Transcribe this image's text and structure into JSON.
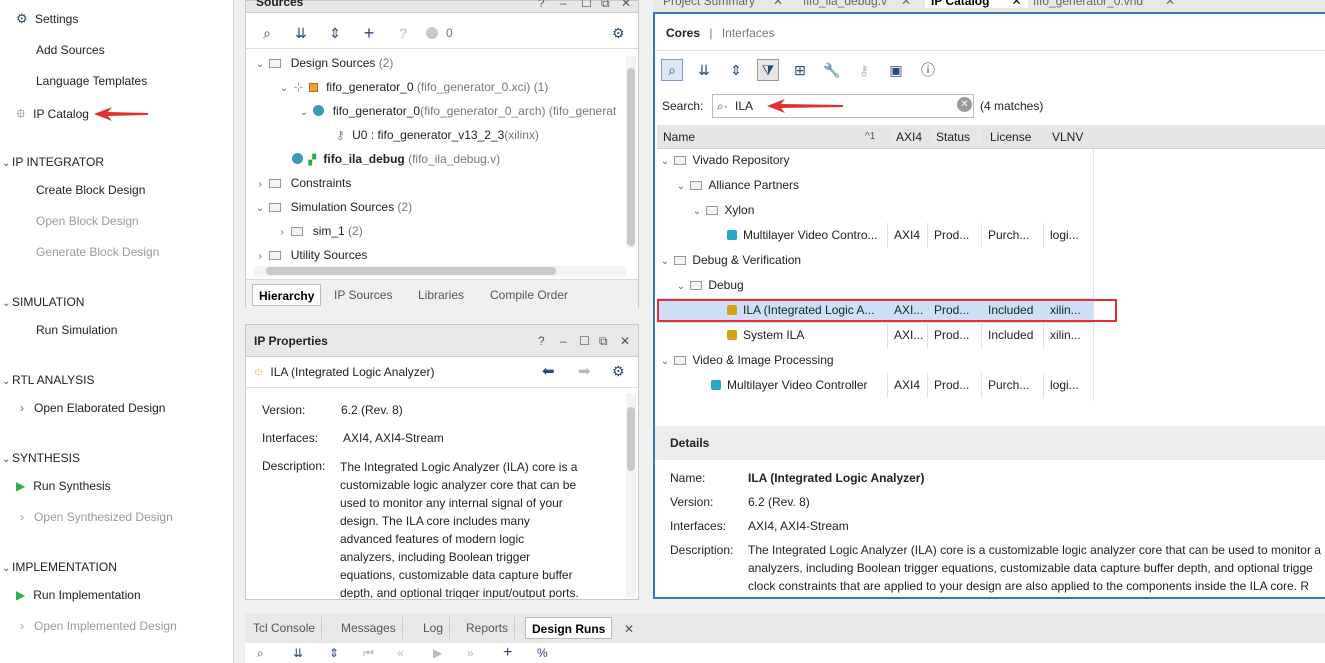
{
  "flow": {
    "settings": "Settings",
    "add_sources": "Add Sources",
    "language_templates": "Language Templates",
    "ip_catalog": "IP Catalog",
    "ip_integrator": "IP INTEGRATOR",
    "create_block_design": "Create Block Design",
    "open_block_design": "Open Block Design",
    "generate_block_design": "Generate Block Design",
    "simulation": "SIMULATION",
    "run_simulation": "Run Simulation",
    "rtl_analysis": "RTL ANALYSIS",
    "open_elaborated_design": "Open Elaborated Design",
    "synthesis": "SYNTHESIS",
    "run_synthesis": "Run Synthesis",
    "open_synthesized_design": "Open Synthesized Design",
    "implementation": "IMPLEMENTATION",
    "run_implementation": "Run Implementation",
    "open_implemented_design": "Open Implemented Design"
  },
  "sources": {
    "title": "Sources",
    "count_badge": "0",
    "design_sources": "Design Sources",
    "design_sources_count": "(2)",
    "fifo_gen": "fifo_generator_0",
    "fifo_gen_file": "(fifo_generator_0.xci) (1)",
    "fifo_gen_arch": "fifo_generator_0",
    "fifo_gen_arch_detail": "(fifo_generator_0_arch) (fifo_generat",
    "u0": "U0 : fifo_generator_v13_2_3",
    "u0_lib": "(xilinx)",
    "fifo_ila_debug": "fifo_ila_debug",
    "fifo_ila_debug_file": "(fifo_ila_debug.v)",
    "constraints": "Constraints",
    "simulation_sources": "Simulation Sources",
    "simulation_sources_count": "(2)",
    "sim_1": "sim_1",
    "sim_1_count": "(2)",
    "utility_sources": "Utility Sources",
    "tabs": [
      "Hierarchy",
      "IP Sources",
      "Libraries",
      "Compile Order"
    ]
  },
  "ip_properties": {
    "title": "IP Properties",
    "name": "ILA (Integrated Logic Analyzer)",
    "version_label": "Version:",
    "version": "6.2 (Rev. 8)",
    "interfaces_label": "Interfaces:",
    "interfaces": "AXI4, AXI4-Stream",
    "description_label": "Description:",
    "description_lines": [
      "The Integrated Logic Analyzer (ILA) core is a",
      "customizable logic analyzer core that can be",
      "used to monitor any internal signal of your",
      "design. The ILA core includes many",
      "advanced features of modern logic",
      "analyzers, including Boolean trigger",
      "equations, customizable data capture buffer",
      "depth, and optional trigger input/output ports."
    ]
  },
  "editor_tabs": [
    "Project Summary",
    "fifo_ila_debug.v",
    "IP Catalog",
    "fifo_generator_0.vhd"
  ],
  "catalog": {
    "subtab_cores": "Cores",
    "subtab_sep": "|",
    "subtab_interfaces": "Interfaces",
    "search_label": "Search:",
    "search_value": "ILA",
    "matches": "(4 matches)",
    "columns": [
      "Name",
      "AXI4",
      "Status",
      "License",
      "VLNV"
    ],
    "sort_indicator": "^1",
    "tree": {
      "vivado_repository": "Vivado Repository",
      "alliance_partners": "Alliance Partners",
      "xylon": "Xylon",
      "debug_verification": "Debug & Verification",
      "debug": "Debug",
      "video_image": "Video & Image Processing"
    },
    "rows": [
      {
        "name": "Multilayer Video Contro...",
        "axi4": "AXI4",
        "status": "Prod...",
        "license": "Purch...",
        "vlnv": "logi..."
      },
      {
        "name": "ILA (Integrated Logic A...",
        "axi4": "AXI...",
        "status": "Prod...",
        "license": "Included",
        "vlnv": "xilin..."
      },
      {
        "name": "System ILA",
        "axi4": "AXI...",
        "status": "Prod...",
        "license": "Included",
        "vlnv": "xilin..."
      },
      {
        "name": "Multilayer Video Controller",
        "axi4": "AXI4",
        "status": "Prod...",
        "license": "Purch...",
        "vlnv": "logi..."
      }
    ],
    "details": {
      "title": "Details",
      "name_label": "Name:",
      "name": "ILA (Integrated Logic Analyzer)",
      "version_label": "Version:",
      "version": "6.2 (Rev. 8)",
      "interfaces_label": "Interfaces:",
      "interfaces": "AXI4, AXI4-Stream",
      "description_label": "Description:",
      "description_lines": [
        "The Integrated Logic Analyzer (ILA) core is a customizable logic analyzer core that can be used to monitor a",
        "analyzers, including Boolean trigger equations, customizable data capture buffer depth, and optional trigge",
        "clock constraints that are applied to your design are also applied to the components inside the ILA core. R"
      ]
    }
  },
  "bottom_tabs": [
    "Tcl Console",
    "Messages",
    "Log",
    "Reports",
    "Design Runs"
  ],
  "colors": {
    "accent_blue": "#3d74b8",
    "highlight_red": "#e03030",
    "run_green": "#2fa84f",
    "selected_row": "#cde0f7"
  }
}
